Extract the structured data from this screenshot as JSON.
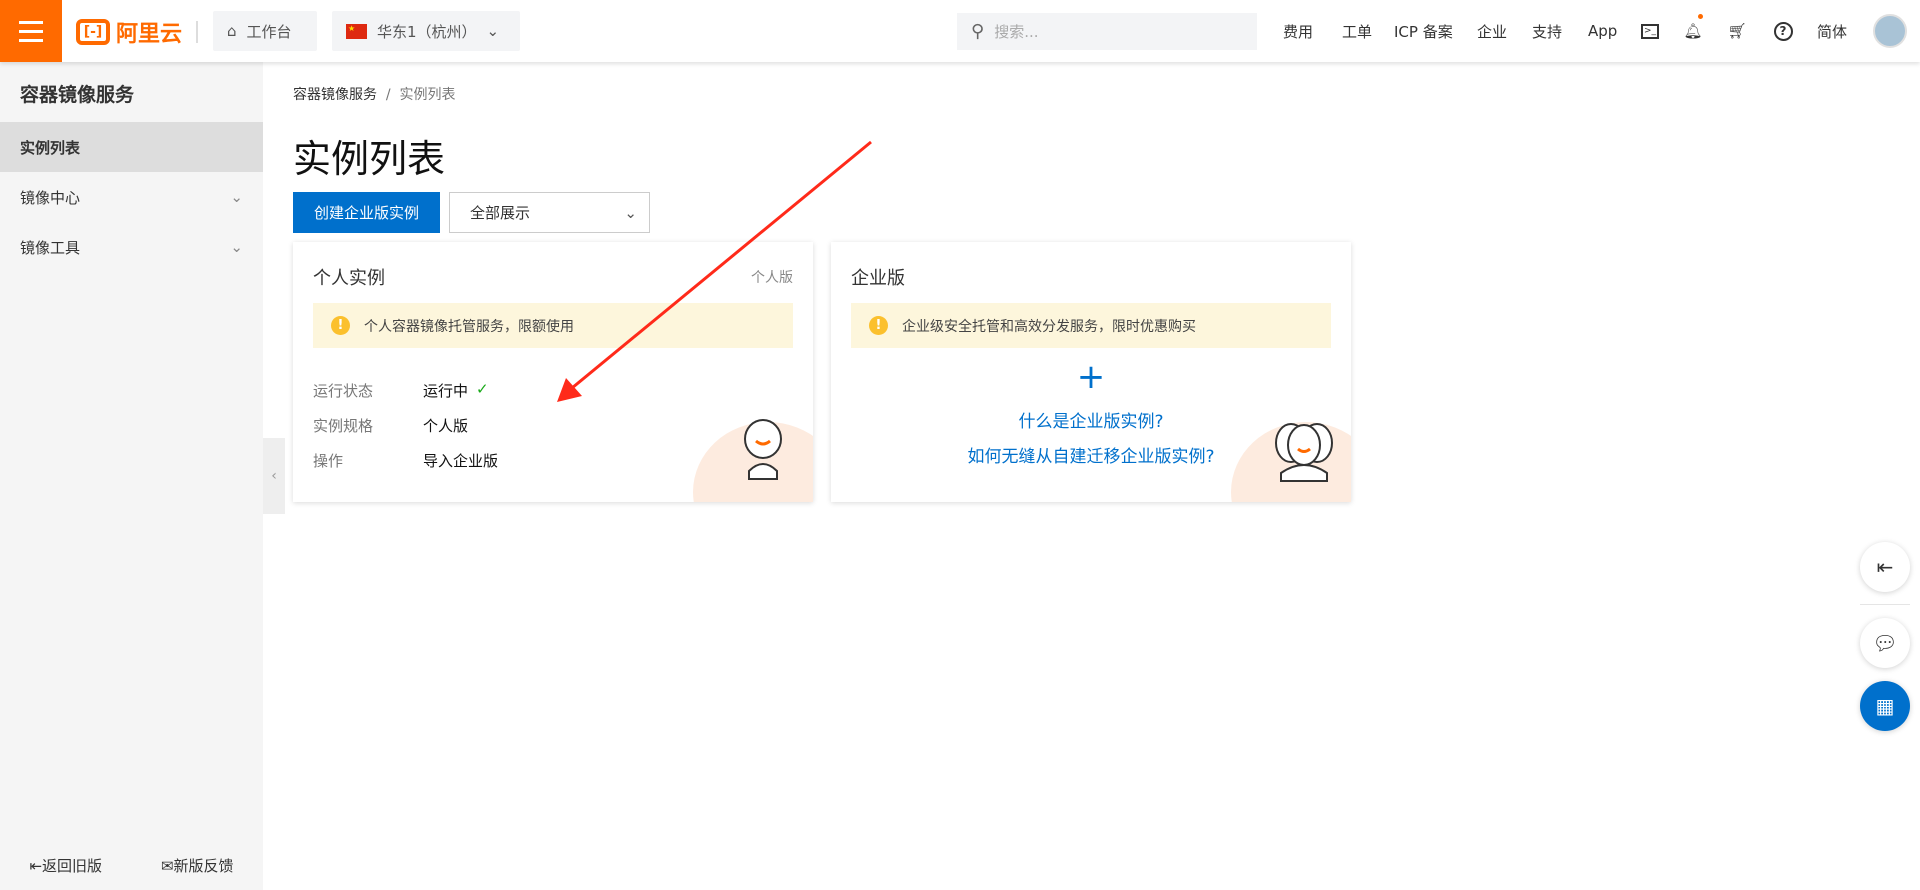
{
  "header": {
    "logo": "阿里云",
    "workbench": "工作台",
    "region": "华东1（杭州）",
    "search_placeholder": "搜索...",
    "nav": [
      "费用",
      "工单",
      "ICP 备案",
      "企业",
      "支持",
      "App"
    ],
    "lang": "简体"
  },
  "sidebar": {
    "title": "容器镜像服务",
    "items": [
      {
        "label": "实例列表"
      },
      {
        "label": "镜像中心"
      },
      {
        "label": "镜像工具"
      }
    ],
    "footer": {
      "old": "返回旧版",
      "feedback": "新版反馈"
    }
  },
  "breadcrumb": {
    "root": "容器镜像服务",
    "sep": "/",
    "current": "实例列表"
  },
  "page": {
    "title": "实例列表",
    "create_button": "创建企业版实例",
    "filter": "全部展示"
  },
  "personal": {
    "title": "个人实例",
    "tag": "个人版",
    "notice": "个人容器镜像托管服务，限额使用",
    "rows": [
      {
        "k": "运行状态",
        "v": "运行中"
      },
      {
        "k": "实例规格",
        "v": "个人版"
      },
      {
        "k": "操作",
        "v": "导入企业版"
      }
    ]
  },
  "enterprise": {
    "title": "企业版",
    "notice": "企业级安全托管和高效分发服务，限时优惠购买",
    "link1": "什么是企业版实例?",
    "link2": "如何无缝从自建迁移企业版实例?"
  },
  "colors": {
    "brand": "#ff6a00",
    "primary": "#0070cc",
    "arrow": "#ff2a1a"
  }
}
